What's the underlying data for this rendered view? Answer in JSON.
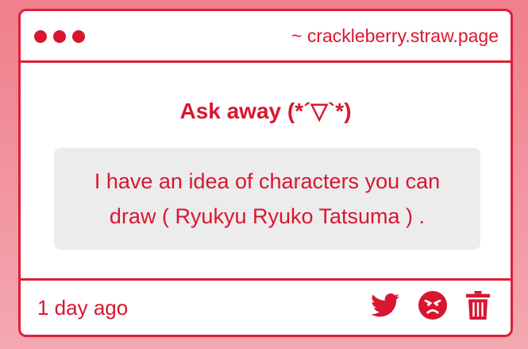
{
  "window": {
    "url": "~ crackleberry.straw.page"
  },
  "main": {
    "heading": "Ask away (*´▽`*)",
    "message": "I have an idea of characters you can draw ( Ryukyu Ryuko Tatsuma ) ."
  },
  "footer": {
    "timestamp": "1 day ago",
    "icons": [
      "twitter-icon",
      "angry-face-icon",
      "trash-icon"
    ]
  },
  "colors": {
    "accent": "#d9162f",
    "border": "#dd1f37",
    "bubble": "#ececed",
    "background_top": "#ef7f8c",
    "background_bottom": "#f4a8b1"
  }
}
